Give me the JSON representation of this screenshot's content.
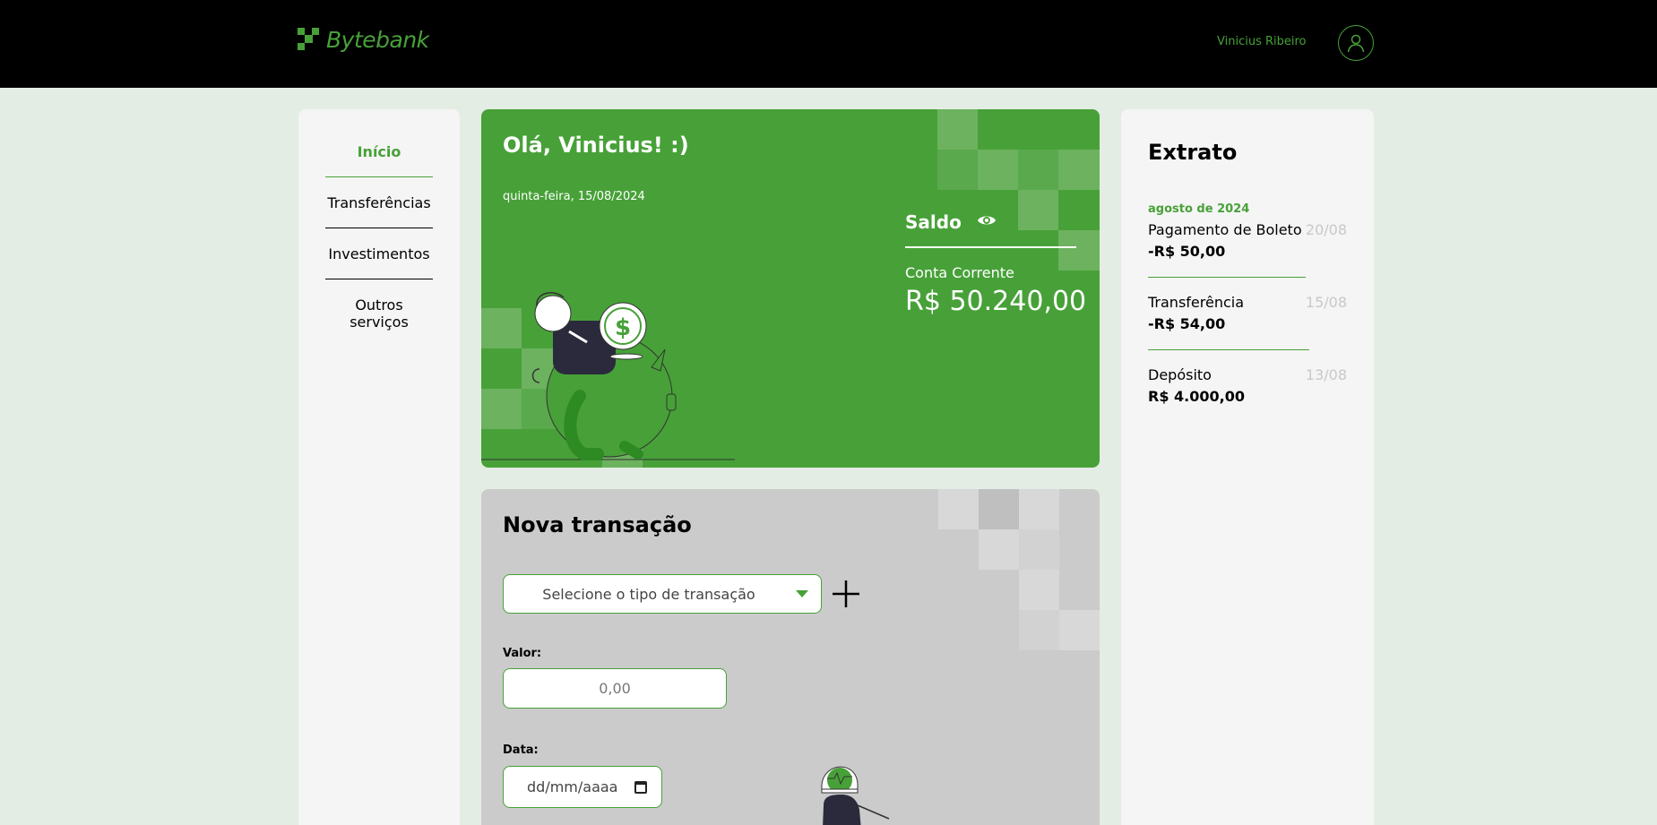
{
  "header": {
    "logo_text": "Bytebank",
    "user_name": "Vinicius Ribeiro"
  },
  "sidebar": {
    "items": [
      {
        "label": "Início",
        "active": true
      },
      {
        "label": "Transferências",
        "active": false
      },
      {
        "label": "Investimentos",
        "active": false
      },
      {
        "label": "Outros serviços",
        "active": false
      }
    ]
  },
  "balance": {
    "greeting": "Olá, Vinicius! :)",
    "date": "quinta-feira, 15/08/2024",
    "title": "Saldo",
    "account_label": "Conta Corrente",
    "account_value": "R$ 50.240,00"
  },
  "transaction": {
    "title": "Nova transação",
    "select_placeholder": "Selecione o tipo de transação",
    "value_label": "Valor:",
    "value_placeholder": "0,00",
    "date_label": "Data:",
    "date_placeholder": "dd/mm/aaaa"
  },
  "extrato": {
    "title": "Extrato",
    "month": "agosto de 2024",
    "entries": [
      {
        "type": "Pagamento de Boleto",
        "amount": "-R$ 50,00",
        "date": "20/08"
      },
      {
        "type": "Transferência",
        "amount": "-R$ 54,00",
        "date": "15/08"
      },
      {
        "type": "Depósito",
        "amount": "R$ 4.000,00",
        "date": "13/08"
      }
    ]
  },
  "colors": {
    "brand": "#47a138",
    "header_bg": "#000000",
    "page_bg": "#e4ede3",
    "card_gray": "#cbcbcb"
  }
}
